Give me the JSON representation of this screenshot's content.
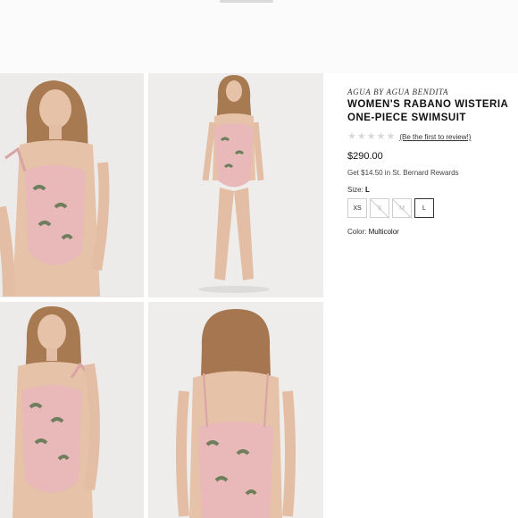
{
  "product": {
    "brand": "AGUA BY AGUA BENDITA",
    "title_line1": "WOMEN'S RABANO WISTERIA",
    "title_line2": "ONE-PIECE SWIMSUIT",
    "review_link": "(Be the first to review!)",
    "rating": 0,
    "price": "$290.00",
    "rewards": "Get $14.50 in St. Bernard Rewards",
    "size_label": "Size:",
    "selected_size": "L",
    "sizes": [
      {
        "label": "XS",
        "available": true,
        "selected": false
      },
      {
        "label": "S",
        "available": false,
        "selected": false
      },
      {
        "label": "M",
        "available": false,
        "selected": false
      },
      {
        "label": "L",
        "available": true,
        "selected": true
      }
    ],
    "color_label": "Color:",
    "color_value": "Multicolor"
  },
  "colors": {
    "swimsuit_pink": "#e8b9b8",
    "floral_green": "#6f7f5e",
    "skin": "#e6c2a8",
    "hair": "#a5764f"
  }
}
